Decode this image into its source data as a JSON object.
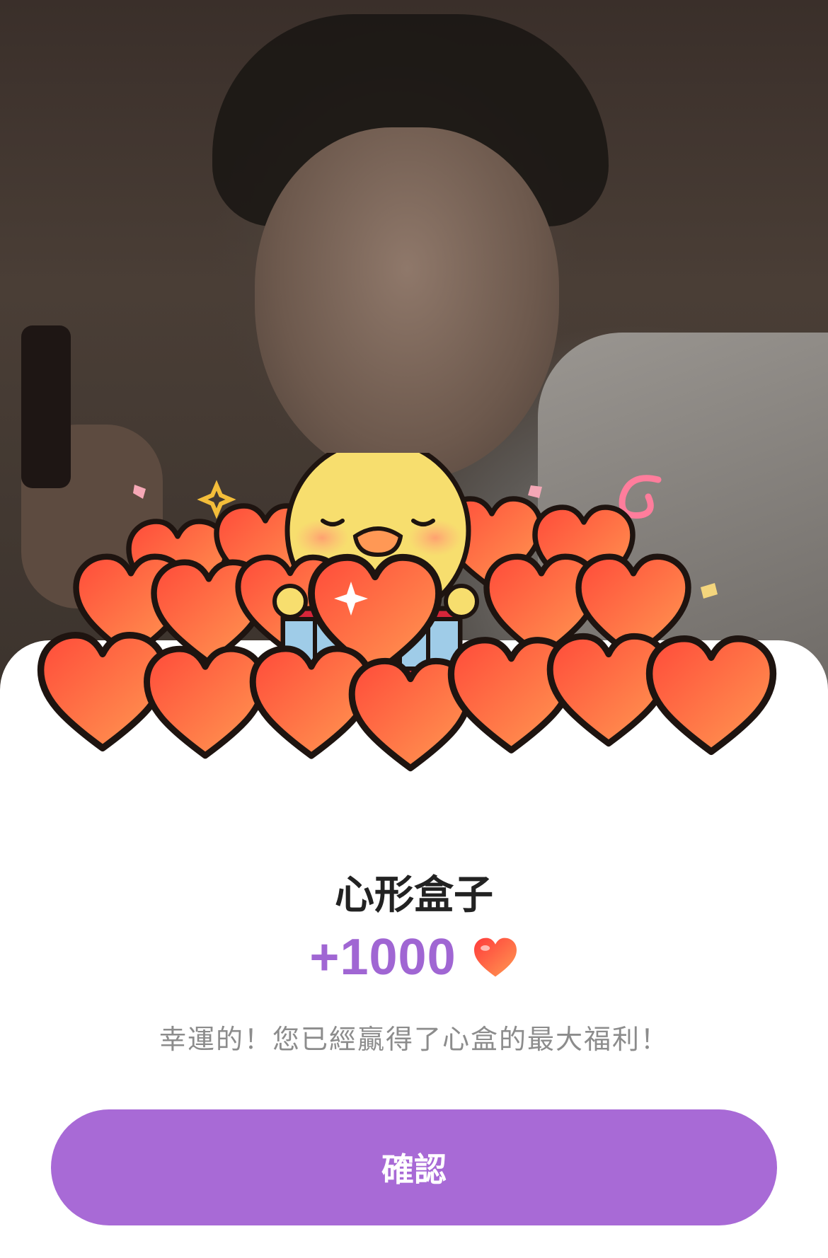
{
  "popup": {
    "title": "心形盒子",
    "reward_amount": "+1000",
    "reward_icon": "heart-icon",
    "message": "幸運的！您已經贏得了心盒的最大福利！",
    "confirm_label": "確認"
  },
  "colors": {
    "accent": "#a86ad6",
    "amount": "#a066d3",
    "heart_light": "#ff8a4a",
    "heart_dark": "#ff4b3a"
  }
}
